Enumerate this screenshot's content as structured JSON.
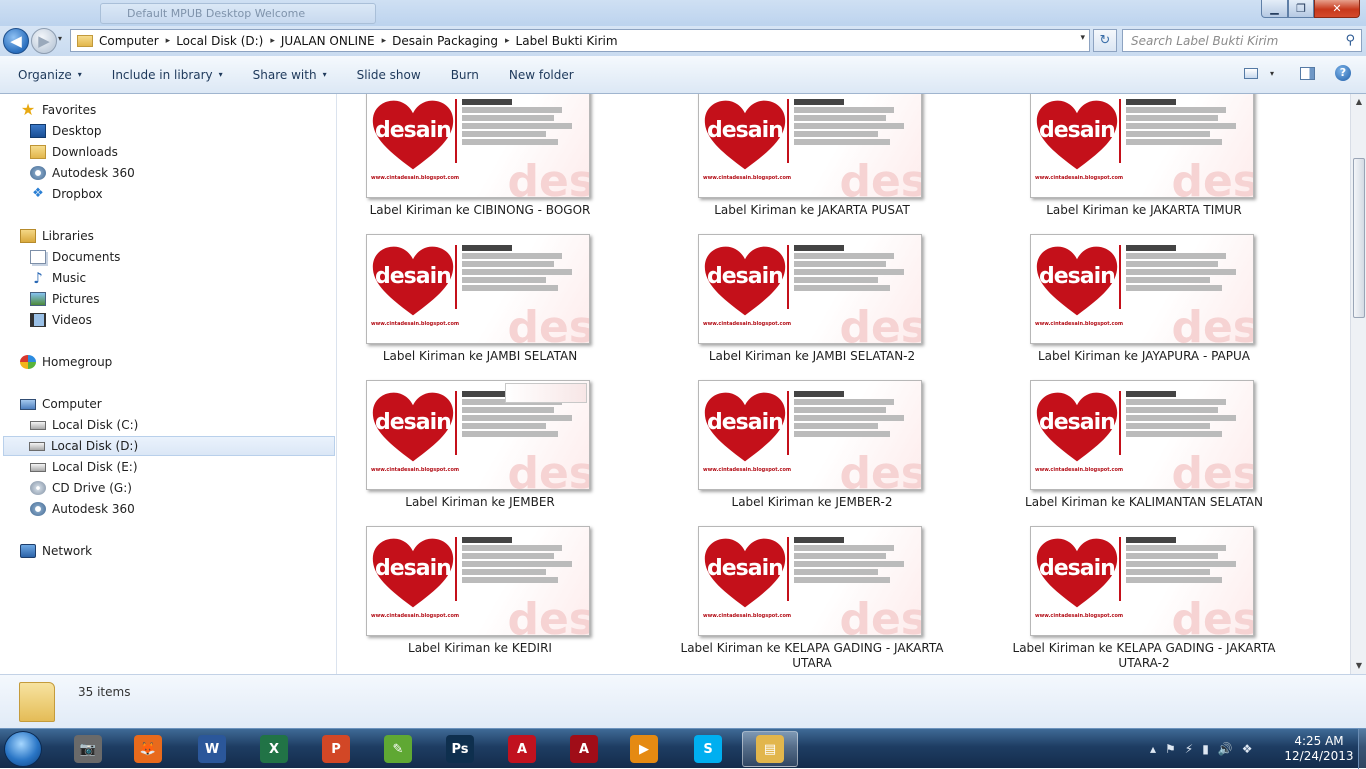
{
  "window": {
    "ghost_tab_title": "Default MPUB Desktop Welcome",
    "min_glyph": "▁",
    "max_glyph": "❐",
    "close_glyph": "✕"
  },
  "address": {
    "breadcrumbs": [
      "Computer",
      "Local Disk (D:)",
      "JUALAN ONLINE",
      "Desain Packaging",
      "Label Bukti Kirim"
    ],
    "separator": "▸",
    "dropdown_glyph": "▾",
    "refresh_glyph": "↻",
    "search_placeholder": "Search Label Bukti Kirim",
    "search_icon": "⚲"
  },
  "nav_glyphs": {
    "back": "◀",
    "forward": "▶",
    "dropdown": "▾"
  },
  "commands": {
    "organize": "Organize",
    "include_in_library": "Include in library",
    "share_with": "Share with",
    "slide_show": "Slide show",
    "burn": "Burn",
    "new_folder": "New folder",
    "caret": "▾",
    "help": "?"
  },
  "nav": {
    "favorites": "Favorites",
    "desktop": "Desktop",
    "downloads": "Downloads",
    "autodesk360": "Autodesk 360",
    "dropbox": "Dropbox",
    "libraries": "Libraries",
    "documents": "Documents",
    "music": "Music",
    "pictures": "Pictures",
    "videos": "Videos",
    "homegroup": "Homegroup",
    "computer": "Computer",
    "drive_c": "Local Disk (C:)",
    "drive_d": "Local Disk (D:)",
    "drive_e": "Local Disk (E:)",
    "drive_g": "CD Drive (G:)",
    "autodesk360_b": "Autodesk 360",
    "network": "Network",
    "icons": {
      "favorites": "★",
      "dropbox": "❖",
      "music": "♪"
    }
  },
  "thumb_text": {
    "brand": "desain",
    "url": "www.cintadesain.blogspot.com",
    "ghost": "des"
  },
  "files": [
    {
      "caption": "Label Kiriman ke CIBINONG - BOGOR"
    },
    {
      "caption": "Label Kiriman ke JAKARTA PUSAT"
    },
    {
      "caption": "Label Kiriman ke JAKARTA TIMUR"
    },
    {
      "caption": "Label Kiriman ke JAMBI SELATAN"
    },
    {
      "caption": "Label Kiriman ke JAMBI SELATAN-2"
    },
    {
      "caption": "Label Kiriman ke JAYAPURA - PAPUA"
    },
    {
      "caption": "Label Kiriman ke JEMBER"
    },
    {
      "caption": "Label Kiriman ke JEMBER-2"
    },
    {
      "caption": "Label Kiriman ke KALIMANTAN SELATAN"
    },
    {
      "caption": "Label Kiriman ke KEDIRI"
    },
    {
      "caption": "Label Kiriman ke KELAPA GADING - JAKARTA UTARA"
    },
    {
      "caption": "Label Kiriman ke KELAPA GADING - JAKARTA UTARA-2"
    }
  ],
  "status": {
    "items_count": "35 items"
  },
  "scroll": {
    "up": "▲",
    "down": "▼"
  },
  "taskbar": {
    "apps": [
      {
        "name": "camera-app",
        "glyph": "📷",
        "color": "#6a6a6a"
      },
      {
        "name": "firefox",
        "glyph": "🦊",
        "color": "#e86a1c"
      },
      {
        "name": "word",
        "glyph": "W",
        "color": "#2b579a"
      },
      {
        "name": "excel",
        "glyph": "X",
        "color": "#217346"
      },
      {
        "name": "powerpoint",
        "glyph": "P",
        "color": "#d24726"
      },
      {
        "name": "corel",
        "glyph": "✎",
        "color": "#5fa833"
      },
      {
        "name": "photoshop",
        "glyph": "Ps",
        "color": "#0e2f4e"
      },
      {
        "name": "autocad-a",
        "glyph": "A",
        "color": "#c1121f"
      },
      {
        "name": "autocad-b",
        "glyph": "A",
        "color": "#a00d18"
      },
      {
        "name": "media-player",
        "glyph": "▶",
        "color": "#e58a12"
      },
      {
        "name": "skype",
        "glyph": "S",
        "color": "#00aff0"
      },
      {
        "name": "explorer",
        "glyph": "▤",
        "color": "#e2b64c"
      }
    ],
    "tray_icons": [
      "▴",
      "⚑",
      "⚡",
      "▮",
      "🔊",
      "❖"
    ],
    "time": "4:25 AM",
    "date": "12/24/2013"
  }
}
